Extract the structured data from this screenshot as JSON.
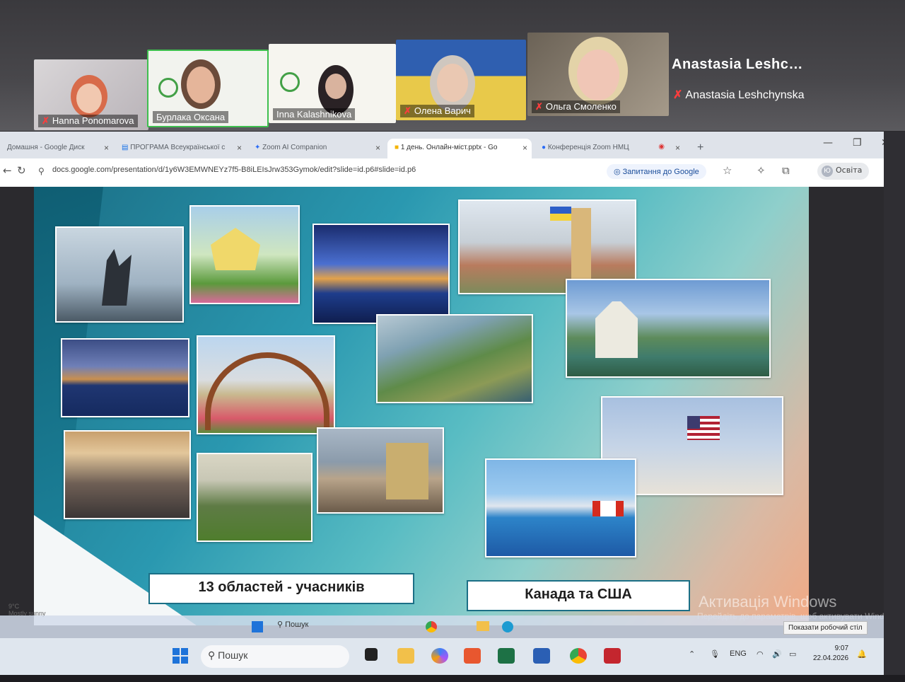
{
  "zoom": {
    "participants": [
      {
        "name": "Hanna Ponomarova",
        "muted": true
      },
      {
        "name": "Бурлака Оксана",
        "muted": false
      },
      {
        "name": "Inna Kalashnikova",
        "muted": false
      },
      {
        "name": "Олена Варич",
        "muted": true
      },
      {
        "name": "Ольга Смоленко",
        "muted": true
      }
    ],
    "speaker_name_large": "Anastasia  Leshc…",
    "speaker_name_small": "Anastasia Leshchynska"
  },
  "browser": {
    "tabs": [
      {
        "label": "Домашня - Google Диск"
      },
      {
        "label": "ПРОГРАМА Всеукраїнської с"
      },
      {
        "label": "Zoom AI Companion"
      },
      {
        "label": "1 день. Онлайн-міст.pptx - Go"
      },
      {
        "label": "Конференція Zoom НМЦ"
      }
    ],
    "new_tab": "+",
    "url": "docs.google.com/presentation/d/1y6W3EMWNEYz7f5-B8iLEIsJrw353Gymok/edit?slide=id.p6#slide=id.p6",
    "ask_google": "Запитання до Google",
    "profile_initial": "Ю",
    "profile_label": "Освіта"
  },
  "slide": {
    "caption_left": "13 областей - учасників",
    "caption_right": "Канада та США"
  },
  "windows_activation": {
    "title": "Активація Windows",
    "subtitle": "Перейдіть до параметрів, щоб активувати Windows."
  },
  "remote_taskbar": {
    "search": "Пошук",
    "show_desktop": "Показати робочий стіл",
    "weather_line1": "9°C",
    "weather_line2": "Mostly sunny"
  },
  "taskbar": {
    "search": "Пошук",
    "language": "ENG",
    "time": "9:07",
    "date": "22.04.2026"
  }
}
